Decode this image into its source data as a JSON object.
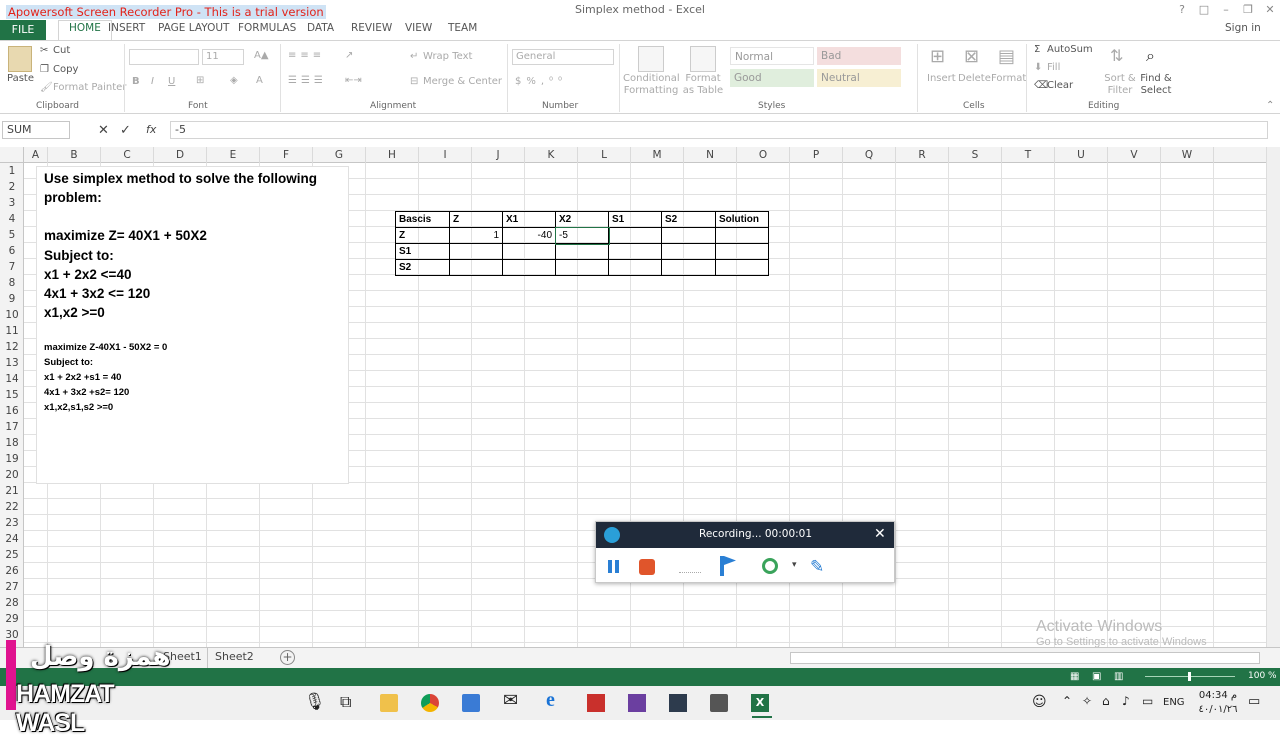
{
  "title_bar": {
    "recorder_banner": "Apowersoft Screen Recorder Pro - This is a trial version",
    "document_title": "Simplex method - Excel",
    "help": "?",
    "ribbon_opts": "□",
    "minimize": "–",
    "restore": "❐",
    "close": "✕"
  },
  "menu": {
    "file": "FILE",
    "tabs": [
      "HOME",
      "INSERT",
      "PAGE LAYOUT",
      "FORMULAS",
      "DATA",
      "REVIEW",
      "VIEW",
      "TEAM"
    ],
    "sign_in": "Sign in"
  },
  "ribbon": {
    "clipboard": {
      "paste": "Paste",
      "cut": "Cut",
      "copy": "Copy",
      "format_painter": "Format Painter",
      "label": "Clipboard"
    },
    "font": {
      "name": "",
      "size": "11",
      "bold": "B",
      "italic": "I",
      "underline": "U",
      "label": "Font"
    },
    "alignment": {
      "wrap": "Wrap Text",
      "merge": "Merge & Center",
      "label": "Alignment"
    },
    "number": {
      "format": "General",
      "label": "Number"
    },
    "styles": {
      "conditional": "Conditional Formatting",
      "format_as_table": "Format as Table",
      "normal": "Normal",
      "bad": "Bad",
      "good": "Good",
      "neutral": "Neutral",
      "label": "Styles"
    },
    "cells": {
      "insert": "Insert",
      "delete": "Delete",
      "format": "Format",
      "label": "Cells"
    },
    "editing": {
      "autosum": "AutoSum",
      "fill": "Fill",
      "clear": "Clear",
      "sort": "Sort & Filter",
      "find": "Find & Select",
      "label": "Editing"
    }
  },
  "formula_bar": {
    "name_box": "SUM",
    "fx": "fx",
    "formula": "-5"
  },
  "columns": [
    "A",
    "B",
    "C",
    "D",
    "E",
    "F",
    "G",
    "H",
    "I",
    "J",
    "K",
    "L",
    "M",
    "N",
    "O",
    "P",
    "Q",
    "R",
    "S",
    "T",
    "U",
    "V",
    "W"
  ],
  "rows": [
    "1",
    "2",
    "3",
    "4",
    "5",
    "6",
    "7",
    "8",
    "9",
    "10",
    "11",
    "12",
    "13",
    "14",
    "15",
    "16",
    "17",
    "18",
    "19",
    "20",
    "21",
    "22",
    "23",
    "24",
    "25",
    "26",
    "27",
    "28",
    "29",
    "30"
  ],
  "textbox": {
    "line1": "Use simplex method to solve the following",
    "line2": "problem:",
    "line3": "maximize Z= 40X1 + 50X2",
    "line4": "Subject to:",
    "line5": "x1 + 2x2 <=40",
    "line6": "4x1 + 3x2 <= 120",
    "line7": "x1,x2 >=0",
    "s1": "maximize Z-40X1 - 50X2 = 0",
    "s2": "Subject to:",
    "s3": "x1 + 2x2 +s1 = 40",
    "s4": "4x1 + 3x2 +s2=  120",
    "s5": "x1,x2,s1,s2 >=0"
  },
  "table": {
    "headers": [
      "Bascis",
      "Z",
      "X1",
      "X2",
      "S1",
      "S2",
      "Solution"
    ],
    "rows": [
      [
        "Z",
        "1",
        "-40",
        "-5",
        "",
        "",
        ""
      ],
      [
        "S1",
        "",
        "",
        "",
        "",
        "",
        ""
      ],
      [
        "S2",
        "",
        "",
        "",
        "",
        "",
        ""
      ]
    ]
  },
  "sheets": {
    "tabs": [
      "Sheet1",
      "Sheet2"
    ],
    "add": "+"
  },
  "status": {
    "zoom": "100 %"
  },
  "recorder": {
    "status": "Recording... 00:00:01",
    "close": "✕"
  },
  "watermark": {
    "line1": "Activate Windows",
    "line2": "Go to Settings to activate Windows"
  },
  "logo": {
    "arabic": "همزة وصل",
    "latin": "HAMZAT WASL"
  },
  "taskbar": {
    "lang": "ENG",
    "time": "04:34 م",
    "date": "٤٠/٠١/٢٦"
  }
}
